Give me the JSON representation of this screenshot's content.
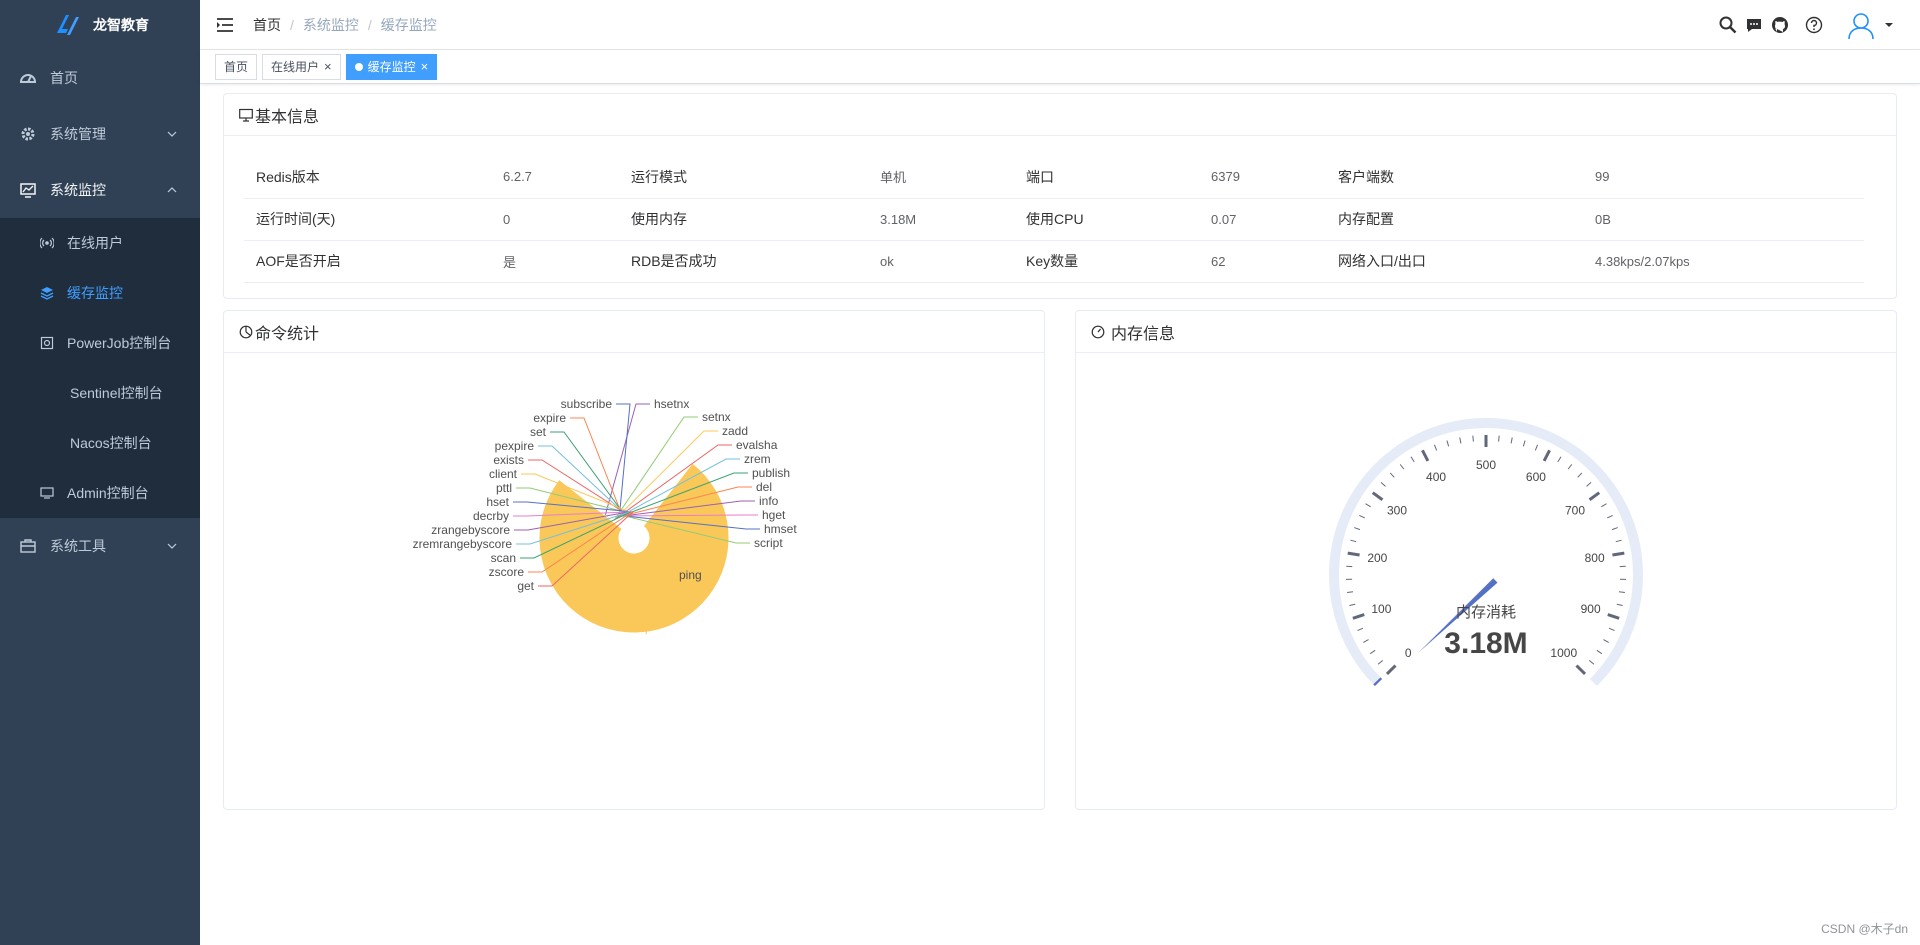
{
  "app": {
    "title": "龙智教育"
  },
  "sidebar": {
    "items": [
      {
        "label": "首页",
        "icon": "dashboard-icon"
      },
      {
        "label": "系统管理",
        "icon": "gear-icon"
      },
      {
        "label": "系统监控",
        "icon": "monitor-icon"
      },
      {
        "label": "系统工具",
        "icon": "toolbox-icon"
      }
    ],
    "monitor_children": [
      {
        "label": "在线用户",
        "icon": "online-icon"
      },
      {
        "label": "缓存监控",
        "icon": "layers-icon"
      },
      {
        "label": "PowerJob控制台",
        "icon": "job-icon"
      },
      {
        "label": "Sentinel控制台"
      },
      {
        "label": "Nacos控制台"
      },
      {
        "label": "Admin控制台",
        "icon": "screen-icon"
      }
    ]
  },
  "breadcrumb": [
    "首页",
    "系统监控",
    "缓存监控"
  ],
  "tags": [
    {
      "label": "首页"
    },
    {
      "label": "在线用户",
      "close": "×"
    },
    {
      "label": "缓存监控",
      "close": "×"
    }
  ],
  "basic": {
    "title": "基本信息",
    "rows": [
      [
        {
          "k": "Redis版本",
          "v": "6.2.7"
        },
        {
          "k": "运行模式",
          "v": "单机"
        },
        {
          "k": "端口",
          "v": "6379"
        },
        {
          "k": "客户端数",
          "v": "99"
        }
      ],
      [
        {
          "k": "运行时间(天)",
          "v": "0"
        },
        {
          "k": "使用内存",
          "v": "3.18M"
        },
        {
          "k": "使用CPU",
          "v": "0.07"
        },
        {
          "k": "内存配置",
          "v": "0B"
        }
      ],
      [
        {
          "k": "AOF是否开启",
          "v": "是"
        },
        {
          "k": "RDB是否成功",
          "v": "ok"
        },
        {
          "k": "Key数量",
          "v": "62"
        },
        {
          "k": "网络入口/出口",
          "v": "4.38kps/2.07kps"
        }
      ]
    ]
  },
  "commands": {
    "title": "命令统计"
  },
  "memory": {
    "title": "内存信息"
  },
  "chart_data": [
    {
      "type": "pie",
      "subtype": "rose",
      "categories": [
        "ping",
        "hsetnx",
        "setnx",
        "zadd",
        "evalsha",
        "zrem",
        "publish",
        "del",
        "info",
        "hget",
        "hmset",
        "script",
        "subscribe",
        "expire",
        "set",
        "pexpire",
        "exists",
        "client",
        "pttl",
        "hset",
        "decrby",
        "zrangebyscore",
        "zremrangebyscore",
        "scan",
        "zscore",
        "get"
      ],
      "values": [
        1000,
        30,
        2,
        2,
        2,
        2,
        2,
        2,
        2,
        2,
        2,
        2,
        8,
        20,
        4,
        2,
        2,
        6,
        2,
        3,
        2,
        2,
        2,
        2,
        2,
        2
      ],
      "colors": [
        "#fac858",
        "#9a60b4",
        "#91cc75",
        "#fac858",
        "#ee6666",
        "#73c0de",
        "#3ba272",
        "#fc8452",
        "#9a60b4",
        "#ea7ccc",
        "#5470c6",
        "#91cc75",
        "#5470c6",
        "#fc8452",
        "#3ba272",
        "#73c0de",
        "#ee6666",
        "#fac858",
        "#91cc75",
        "#5470c6",
        "#ea7ccc",
        "#9a60b4",
        "#73c0de",
        "#3ba272",
        "#fc8452",
        "#ee6666"
      ]
    },
    {
      "type": "gauge",
      "name": "内存消耗",
      "value": 3.18,
      "display": "3.18M",
      "min": 0,
      "max": 1000,
      "ticks": [
        "0",
        "100",
        "200",
        "300",
        "400",
        "500",
        "600",
        "700",
        "800",
        "900",
        "1000"
      ]
    }
  ],
  "watermark": "CSDN @木子dn"
}
